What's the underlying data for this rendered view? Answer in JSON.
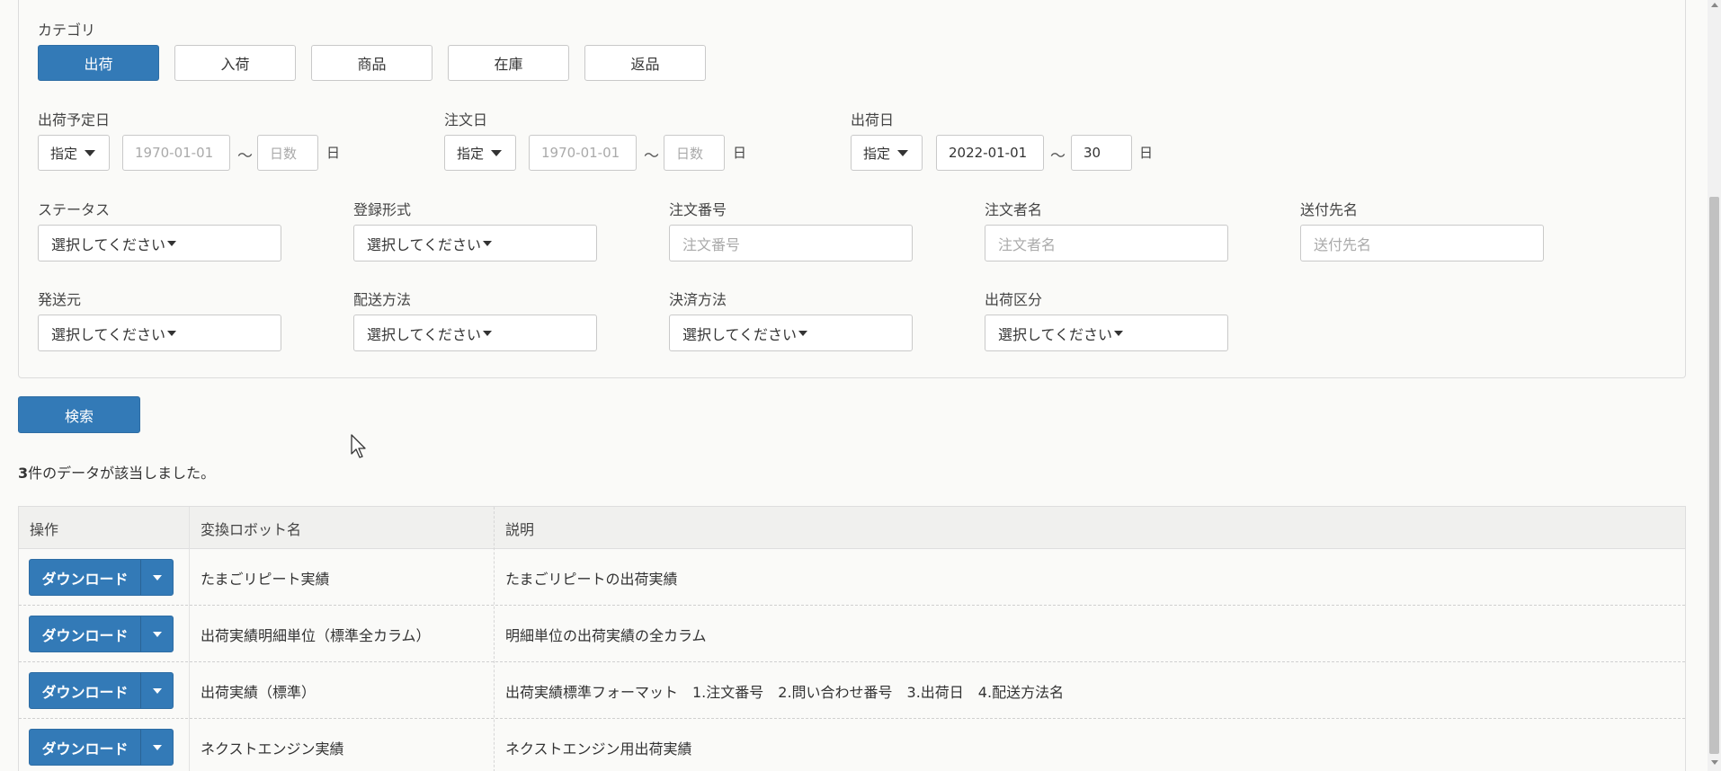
{
  "filters": {
    "category_label": "カテゴリ",
    "categories": [
      {
        "label": "出荷",
        "active": true
      },
      {
        "label": "入荷",
        "active": false
      },
      {
        "label": "商品",
        "active": false
      },
      {
        "label": "在庫",
        "active": false
      },
      {
        "label": "返品",
        "active": false
      }
    ],
    "date_groups": [
      {
        "label": "出荷予定日",
        "mode": "指定",
        "from_placeholder": "1970-01-01",
        "from_value": "",
        "days_placeholder": "日数",
        "days_value": "",
        "tilde": "〜",
        "unit": "日"
      },
      {
        "label": "注文日",
        "mode": "指定",
        "from_placeholder": "1970-01-01",
        "from_value": "",
        "days_placeholder": "日数",
        "days_value": "",
        "tilde": "〜",
        "unit": "日"
      },
      {
        "label": "出荷日",
        "mode": "指定",
        "from_placeholder": "",
        "from_value": "2022-01-01",
        "days_placeholder": "",
        "days_value": "30",
        "tilde": "〜",
        "unit": "日"
      }
    ],
    "row1": [
      {
        "label": "ステータス",
        "type": "select",
        "value": "選択してください"
      },
      {
        "label": "登録形式",
        "type": "select",
        "value": "選択してください"
      },
      {
        "label": "注文番号",
        "type": "text",
        "placeholder": "注文番号"
      },
      {
        "label": "注文者名",
        "type": "text",
        "placeholder": "注文者名"
      },
      {
        "label": "送付先名",
        "type": "text",
        "placeholder": "送付先名"
      }
    ],
    "row2": [
      {
        "label": "発送元",
        "type": "select",
        "value": "選択してください"
      },
      {
        "label": "配送方法",
        "type": "select",
        "value": "選択してください"
      },
      {
        "label": "決済方法",
        "type": "select",
        "value": "選択してください"
      },
      {
        "label": "出荷区分",
        "type": "select",
        "value": "選択してください"
      }
    ],
    "search_label": "検索"
  },
  "result": {
    "count": "3",
    "suffix": "件のデータが該当しました。"
  },
  "table": {
    "headers": [
      "操作",
      "変換ロボット名",
      "説明"
    ],
    "download_label": "ダウンロード",
    "rows": [
      {
        "name": "たまごリピート実績",
        "desc": "たまごリピートの出荷実績"
      },
      {
        "name": "出荷実績明細単位（標準全カラム）",
        "desc": "明細単位の出荷実績の全カラム"
      },
      {
        "name": "出荷実績（標準）",
        "desc": "出荷実績標準フォーマット　1.注文番号　2.問い合わせ番号　3.出荷日　4.配送方法名"
      },
      {
        "name": "ネクストエンジン実績",
        "desc": "ネクストエンジン用出荷実績"
      }
    ]
  },
  "colors": {
    "primary": "#337ab7"
  }
}
